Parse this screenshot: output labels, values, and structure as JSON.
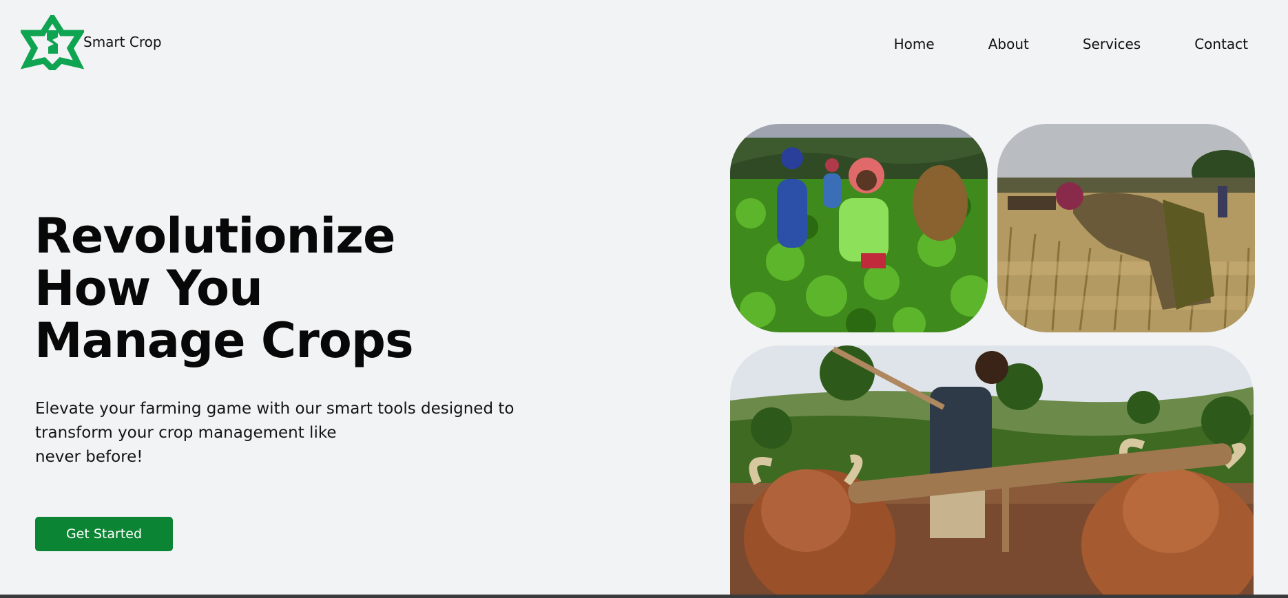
{
  "header": {
    "logo_icon": "star-logo-icon",
    "brand_name": "Smart Crop",
    "accent_color": "#0b8534",
    "nav": [
      {
        "label": "Home"
      },
      {
        "label": "About"
      },
      {
        "label": "Services"
      },
      {
        "label": "Contact"
      }
    ]
  },
  "hero": {
    "title_lines": [
      "Revolutionize",
      "How You",
      "Manage Crops"
    ],
    "description_lines": [
      "Elevate your farming game with our smart tools designed to",
      "transform your crop management like",
      "never before!"
    ],
    "cta_label": "Get Started"
  },
  "gallery": {
    "images": [
      {
        "name": "tea-pickers-photo"
      },
      {
        "name": "wheat-harvester-photo"
      },
      {
        "name": "oxen-plowing-photo"
      }
    ]
  }
}
